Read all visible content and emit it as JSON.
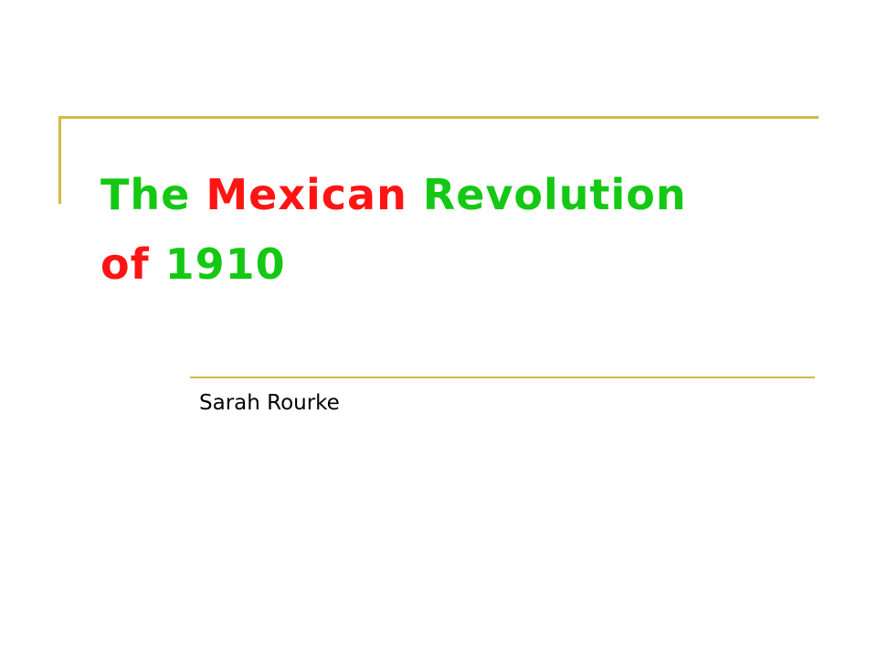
{
  "slide": {
    "title": {
      "line1": [
        {
          "text": "The ",
          "color": "#14c814"
        },
        {
          "text": "Mexican",
          "color": "#ff1414"
        },
        {
          "text": " Revolution",
          "color": "#14c814"
        }
      ],
      "line2": [
        {
          "text": "of ",
          "color": "#ff1414"
        },
        {
          "text": "1910",
          "color": "#14c814"
        }
      ]
    },
    "subtitle": "Sarah Rourke",
    "accent_color": "#d4b946"
  }
}
